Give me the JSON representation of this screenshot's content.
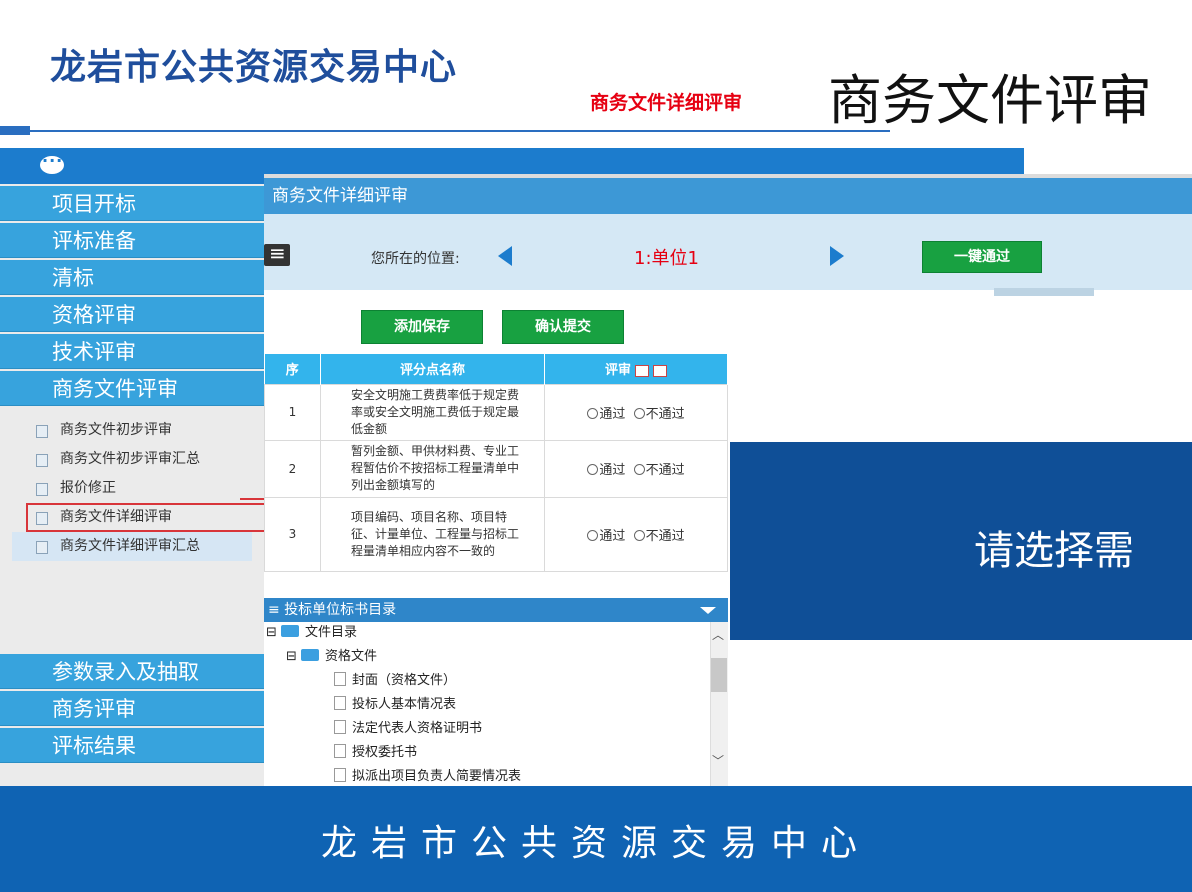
{
  "header": {
    "title": "龙岩市公共资源交易中心",
    "subtitle": "商务文件详细评审",
    "heading": "商务文件评审"
  },
  "sidebar": {
    "menu_top": [
      {
        "label": "项目开标"
      },
      {
        "label": "评标准备"
      },
      {
        "label": "清标"
      },
      {
        "label": "资格评审"
      },
      {
        "label": "技术评审"
      },
      {
        "label": "商务文件评审"
      }
    ],
    "submenu": [
      {
        "label": "商务文件初步评审"
      },
      {
        "label": "商务文件初步评审汇总"
      },
      {
        "label": "报价修正"
      },
      {
        "label": "商务文件详细评审"
      },
      {
        "label": "商务文件详细评审汇总"
      }
    ],
    "menu_bottom": [
      {
        "label": "参数录入及抽取"
      },
      {
        "label": "商务评审"
      },
      {
        "label": "评标结果"
      }
    ]
  },
  "panel": {
    "title": "商务文件详细评审",
    "location_label": "您所在的位置:",
    "current_unit": "1:单位1",
    "pass_all_button": "一键通过",
    "save_button": "添加保存",
    "submit_button": "确认提交"
  },
  "table": {
    "headers": [
      "序",
      "评分点名称",
      "评审"
    ],
    "rows": [
      {
        "seq": "1",
        "name": "安全文明施工费费率低于规定费率或安全文明施工费低于规定最低金额"
      },
      {
        "seq": "2",
        "name": "暂列金额、甲供材料费、专业工程暂估价不按招标工程量清单中列出金额填写的"
      },
      {
        "seq": "3",
        "name": "项目编码、项目名称、项目特征、计量单位、工程量与招标工程量清单相应内容不一致的"
      }
    ],
    "option_pass": "通过",
    "option_fail": "不通过"
  },
  "tree": {
    "title": "投标单位标书目录",
    "root": "文件目录",
    "folder": "资格文件",
    "files": [
      "封面（资格文件）",
      "投标人基本情况表",
      "法定代表人资格证明书",
      "授权委托书",
      "拟派出项目负责人简要情况表"
    ]
  },
  "right_pane": {
    "text": "请选择需"
  },
  "footer": {
    "text": "龙岩市公共资源交易中心"
  }
}
